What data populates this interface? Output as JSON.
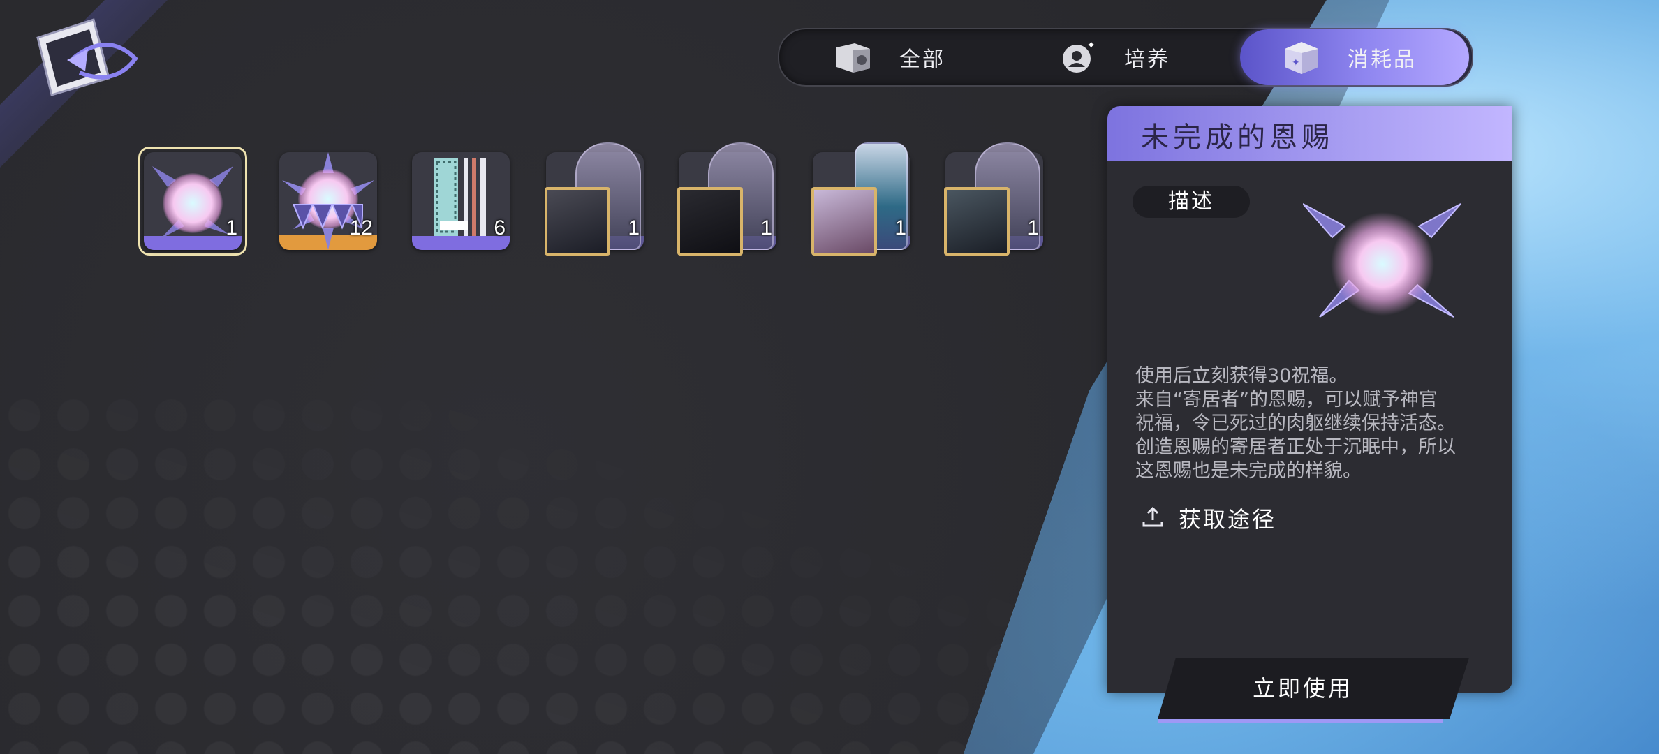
{
  "tabs": [
    {
      "label": "全部",
      "icon": "box-icon"
    },
    {
      "label": "培养",
      "icon": "growth-icon"
    },
    {
      "label": "消耗品",
      "icon": "consumable-box-icon",
      "active": true
    }
  ],
  "items": [
    {
      "name": "unfinished-grace",
      "count": "1",
      "rarity_color": "#7f6de0",
      "selected": true
    },
    {
      "name": "spiked-orb",
      "count": "12",
      "rarity_color": "#e29a3e"
    },
    {
      "name": "cloth-scroll",
      "count": "6",
      "rarity_color": "#7f6de0"
    },
    {
      "name": "character-dome-1",
      "count": "1",
      "rarity_color": "#7f6de0"
    },
    {
      "name": "character-dome-2",
      "count": "1",
      "rarity_color": "#7f6de0"
    },
    {
      "name": "character-jar",
      "count": "1",
      "rarity_color": "#7f6de0"
    },
    {
      "name": "character-dome-3",
      "count": "1",
      "rarity_color": "#7f6de0"
    }
  ],
  "detail": {
    "title": "未完成的恩赐",
    "desc_tag": "描述",
    "description": "使用后立刻获得30祝福。\n来自“寄居者”的恩赐，可以赋予神官\n祝福，令已死过的肉躯继续保持活态。\n创造恩赐的寄居者正处于沉眠中，所以\n这恩赐也是未完成的样貌。",
    "source_label": "获取途径",
    "use_button": "立即使用"
  },
  "colors": {
    "accent": "#8f86f0",
    "selected_border": "#efe3b0",
    "background": "#2b2b30"
  }
}
